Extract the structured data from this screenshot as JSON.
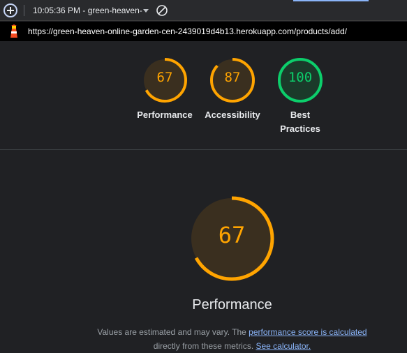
{
  "toolbar": {
    "report_label": "10:05:36 PM - green-heaven-",
    "add_icon": "plus-circle-icon",
    "clear_icon": "block-icon"
  },
  "urlbar": {
    "icon": "lighthouse-icon",
    "url": "https://green-heaven-online-garden-cen-2439019d4b13.herokuapp.com/products/add/"
  },
  "scores": [
    {
      "label": "Performance",
      "score": 67,
      "color": "#ffa400"
    },
    {
      "label": "Accessibility",
      "score": 87,
      "color": "#ffa400"
    },
    {
      "label": "Best Practices",
      "label_line1": "Best",
      "label_line2": "Practices",
      "score": 100,
      "color": "#0cce6b"
    }
  ],
  "main": {
    "score": 67,
    "title": "Performance",
    "color": "#ffa400",
    "note_prefix": "Values are estimated and may vary. The ",
    "note_link1": "performance score is calculated",
    "note_middle": "directly from these metrics. ",
    "note_link2": "See calculator."
  }
}
